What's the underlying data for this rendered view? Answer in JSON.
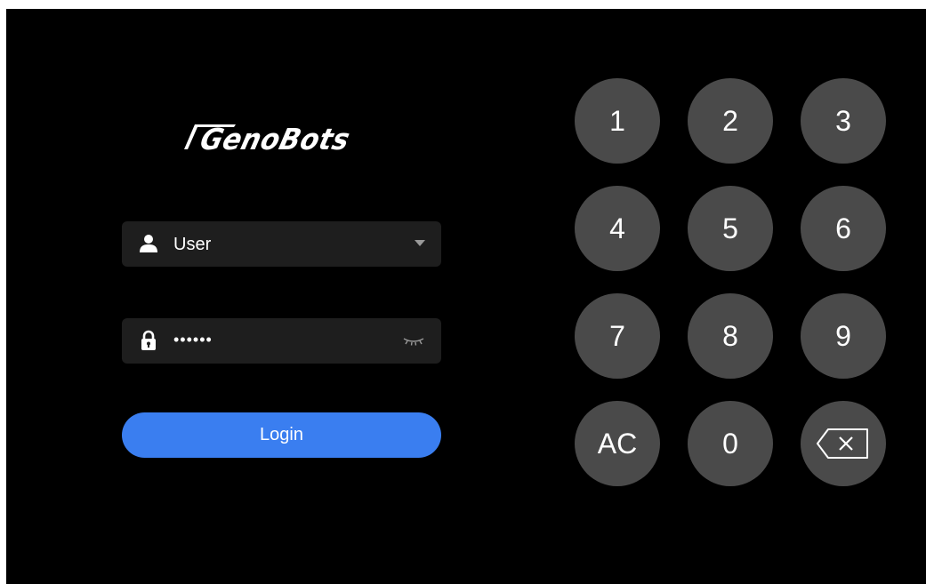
{
  "logo": {
    "text": "GenoBots"
  },
  "user_select": {
    "icon": "user-icon",
    "value": "User",
    "arrow_icon": "caret-down-icon"
  },
  "password_field": {
    "icon": "lock-icon",
    "value": "••••••",
    "toggle_icon": "eye-closed-icon"
  },
  "login_button": {
    "label": "Login",
    "color": "#3a7ef0"
  },
  "keypad": {
    "keys": [
      "1",
      "2",
      "3",
      "4",
      "5",
      "6",
      "7",
      "8",
      "9",
      "AC",
      "0",
      "⌫"
    ],
    "backspace_icon": "backspace-icon",
    "key_color": "#4a4a4a"
  },
  "colors": {
    "background": "#000000",
    "field_background": "#1e1e1e"
  }
}
